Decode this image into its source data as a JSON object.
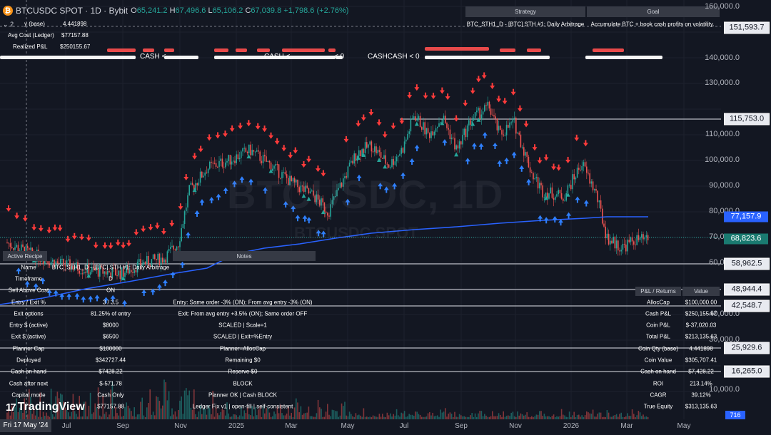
{
  "header": {
    "symbol": "BTCUSDC SPOT · 1D · Bybit",
    "ohlc": [
      {
        "k": "O",
        "v": "65,241.2"
      },
      {
        "k": "H",
        "v": "67,496.6"
      },
      {
        "k": "L",
        "v": "65,106.2"
      },
      {
        "k": "C",
        "v": "67,039.8"
      },
      {
        "k": "",
        "v": "+1,798.6 (+2.76%)"
      }
    ],
    "btc_glyph": "₿"
  },
  "watermark": {
    "line1": "BTCUSDC, 1D",
    "line2": "BTCUSDC SPOT"
  },
  "ledger": {
    "collapse": "2",
    "rows": [
      {
        "label": "y (base)",
        "value": "4.441898"
      },
      {
        "label": "Avg Cost (Ledger)",
        "value": "$77157.88"
      },
      {
        "label": "Realized P&L",
        "value": "$250155.67"
      }
    ]
  },
  "cash_labels": [
    "CASH < ",
    "CASH < ",
    "< 0",
    "CASHCASH < 0"
  ],
  "strategy_table": {
    "headers": [
      "Strategy",
      "Goal"
    ],
    "row": [
      "BTC_STH1_D - [BTC] STH #1: Daily Arbitrage",
      "Accumulate BTC + book cash profits on volatility."
    ]
  },
  "recipe_table": {
    "headers": [
      "Active Recipe",
      "Notes"
    ],
    "rows": [
      [
        "Name",
        "BTC_STH1_D - [BTC] STH #1: Daily Arbitrage",
        ""
      ],
      [
        "Timeframe",
        "D",
        ""
      ],
      [
        "Sell Above Cost",
        "ON",
        ""
      ],
      [
        "Entry / Exit %",
        "3 / 3.5",
        "Entry: Same order -3% (ON); From avg entry -3% (ON)"
      ],
      [
        "Exit options",
        "81.25% of entry",
        "Exit: From avg entry +3.5% (ON); Same order OFF"
      ],
      [
        "Entry $ (active)",
        "$8000",
        "SCALED | Scale=1"
      ],
      [
        "Exit $ (active)",
        "$6500",
        "SCALED | Exit=%Entry"
      ],
      [
        "Planner Cap",
        "$100000",
        "Planner=AllocCap"
      ],
      [
        "Deployed",
        "$342727.44",
        "Remaining $0"
      ],
      [
        "Cash on hand",
        "$7428.22",
        "Reserve $0"
      ],
      [
        "Cash after next",
        "$-571.78",
        "BLOCK"
      ],
      [
        "Capital mode",
        "Cash Only",
        "Planner OK | Cash BLOCK"
      ],
      [
        "",
        "$77157.88",
        "Ledger Fix v1 | open-fill | self-consistent"
      ]
    ]
  },
  "pnl_table": {
    "headers": [
      "P&L / Returns",
      "Value"
    ],
    "rows": [
      [
        "AllocCap",
        "$100,000.00"
      ],
      [
        "Cash P&L",
        "$250,155.67"
      ],
      [
        "Coin P&L",
        "$-37,020.03"
      ],
      [
        "Total P&L",
        "$213,135.63"
      ],
      [
        "Coin Qty (base)",
        "4.441898"
      ],
      [
        "Coin Value",
        "$305,707.41"
      ],
      [
        "Cash on hand",
        "$7,428.22"
      ],
      [
        "ROI",
        "213.14%"
      ],
      [
        "CAGR",
        "39.12%"
      ],
      [
        "True Equity",
        "$313,135.63"
      ]
    ]
  },
  "price_axis": {
    "ticks": [
      "160,000.0",
      "140,000.0",
      "130,000.0",
      "110,000.0",
      "100,000.0",
      "90,000.0",
      "80,000.0",
      "70,000.0",
      "60,000.0",
      "40,000.0",
      "30,000.0",
      "10,000.0"
    ],
    "labels": [
      {
        "text": "151,593.7",
        "style": "white"
      },
      {
        "text": "115,753.0",
        "style": "white"
      },
      {
        "text": "77,157.9",
        "style": "blue"
      },
      {
        "text": "68,823.6",
        "style": "teal"
      },
      {
        "text": "58,962.5",
        "style": "white"
      },
      {
        "text": "48,944.4",
        "style": "white"
      },
      {
        "text": "42,548.7",
        "style": "white"
      },
      {
        "text": "25,929.6",
        "style": "white"
      },
      {
        "text": "16,265.0",
        "style": "white"
      }
    ],
    "volume_value": "716"
  },
  "time_axis": {
    "current": "Fri 17 May '24",
    "ticks": [
      "Jul",
      "Sep",
      "Nov",
      "2025",
      "Mar",
      "May",
      "Jul",
      "Sep",
      "Nov",
      "2026",
      "Mar",
      "May"
    ]
  },
  "branding": {
    "logo_mark": "17",
    "name": "TradingView"
  },
  "colors": {
    "background": "#131722",
    "up": "#26a69a",
    "down": "#ef5350",
    "avg_cost": "#2962ff",
    "sell_marker": "#ff3b3b",
    "buy_marker": "#2f80ff",
    "signal_marker": "#26a69a"
  }
}
